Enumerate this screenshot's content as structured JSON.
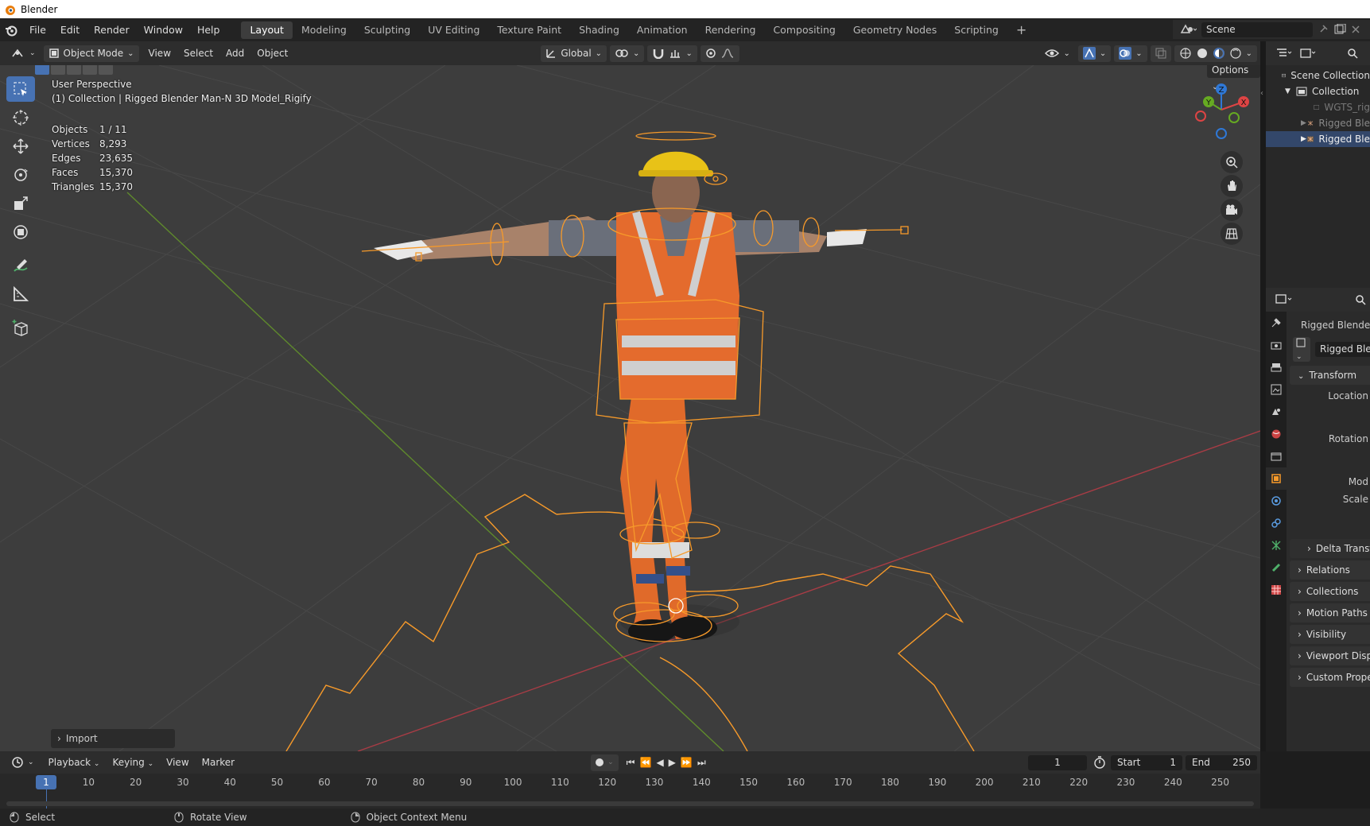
{
  "window": {
    "title": "Blender"
  },
  "menu": {
    "items": [
      "File",
      "Edit",
      "Render",
      "Window",
      "Help"
    ]
  },
  "workspaces": {
    "tabs": [
      "Layout",
      "Modeling",
      "Sculpting",
      "UV Editing",
      "Texture Paint",
      "Shading",
      "Animation",
      "Rendering",
      "Compositing",
      "Geometry Nodes",
      "Scripting"
    ],
    "active": "Layout",
    "add": "+"
  },
  "scene": {
    "name": "Scene"
  },
  "viewport_header": {
    "mode": "Object Mode",
    "menus": [
      "View",
      "Select",
      "Add",
      "Object"
    ],
    "orientation": "Global",
    "options": "Options"
  },
  "viewport": {
    "perspective": "User Perspective",
    "collection_line": "(1) Collection | Rigged Blender Man-N 3D Model_Rigify",
    "stats": [
      {
        "label": "Objects",
        "value": "1 / 11"
      },
      {
        "label": "Vertices",
        "value": "8,293"
      },
      {
        "label": "Edges",
        "value": "23,635"
      },
      {
        "label": "Faces",
        "value": "15,370"
      },
      {
        "label": "Triangles",
        "value": "15,370"
      }
    ],
    "gizmo": {
      "x": "X",
      "y": "Y",
      "z": "Z"
    },
    "last_operator": "Import",
    "colors": {
      "bg": "#3d3d3d",
      "grid": "#484848",
      "x_axis": "#a83c45",
      "y_axis": "#5f8a2c",
      "rig": "#f79a2a"
    }
  },
  "outliner": {
    "items": [
      {
        "label": "Scene Collection"
      },
      {
        "label": "Collection"
      },
      {
        "label": "WGTS_rig"
      },
      {
        "label": "Rigged Ble"
      },
      {
        "label": "Rigged Ble"
      }
    ]
  },
  "properties": {
    "object_name": "Rigged Blender",
    "data_name": "Rigged Blen",
    "transform": "Transform",
    "labels": {
      "location": "Location",
      "rotation": "Rotation",
      "mode": "Mod",
      "scale": "Scale"
    },
    "delta": "Delta Transf",
    "panels": [
      "Relations",
      "Collections",
      "Motion Paths",
      "Visibility",
      "Viewport Displa",
      "Custom Propert"
    ]
  },
  "timeline": {
    "menus": [
      "Playback",
      "Keying",
      "View",
      "Marker"
    ],
    "current_frame": "1",
    "start_label": "Start",
    "start": "1",
    "end_label": "End",
    "end": "250",
    "ticks": [
      "1",
      "10",
      "20",
      "30",
      "40",
      "50",
      "60",
      "70",
      "80",
      "90",
      "100",
      "110",
      "120",
      "130",
      "140",
      "150",
      "160",
      "170",
      "180",
      "190",
      "200",
      "210",
      "220",
      "230",
      "240",
      "250"
    ]
  },
  "statusbar": {
    "items": [
      "Select",
      "Rotate View",
      "Object Context Menu"
    ]
  }
}
